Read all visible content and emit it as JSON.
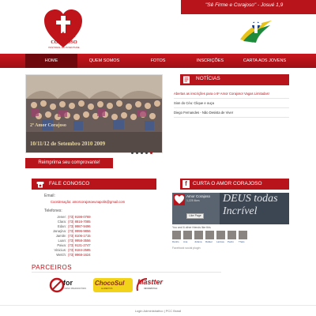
{
  "header": {
    "logo_text": "AMOR",
    "logo_text2": "CORAJOSO",
    "logo_sub": "PASTORAL DA JUVENTUDE",
    "quote": "\"Sê Firme e Corajoso\" - Josué 1,9"
  },
  "nav": {
    "items": [
      {
        "label": "HOME"
      },
      {
        "label": "QUEM SOMOS"
      },
      {
        "label": "FOTOS"
      },
      {
        "label": "INSCRIÇÕES"
      },
      {
        "label": "CARTA AOS JOVENS"
      }
    ]
  },
  "slider": {
    "caption": "2º Amor Corajoso",
    "date": "10/11/12 de Setembro 2010 2009",
    "dots": 5,
    "active_dot": 4
  },
  "reprint_label": "Reimprima seu comprovante!",
  "news": {
    "title": "NOTÍCIAS",
    "items": [
      {
        "text": "Abertas as inscrições para o 6º Amor Corajoso! Vagas Limitadas!",
        "highlight": true
      },
      {
        "text": "Sion do Céu: Clique e ouça",
        "highlight": false
      },
      {
        "text": "Diego Fernandes - Não Desista de Viver",
        "highlight": false
      }
    ]
  },
  "contact": {
    "title": "FALE CONOSCO",
    "email_label": "Email:",
    "email_line": "Coordenação: amorcorajosoeunapolis@gmail.com",
    "phones_label": "Telefones:",
    "phones": [
      {
        "name": "Jener:",
        "number": "(73) 9198-0769"
      },
      {
        "name": "Clara:",
        "number": "(73) 8816-7085"
      },
      {
        "name": "Edan:",
        "number": "(73) 9987-9496"
      },
      {
        "name": "Janaýna:",
        "number": "(73) 9996-9856"
      },
      {
        "name": "Jamile:",
        "number": "(73) 8106-1715"
      },
      {
        "name": "Luan:",
        "number": "(73) 9958-3556"
      },
      {
        "name": "Paiva:",
        "number": "(73) 9131-2747"
      },
      {
        "name": "Vinicius:",
        "number": "(73) 9184-2585"
      },
      {
        "name": "Welch:",
        "number": "(73) 9968-1624"
      }
    ]
  },
  "facebook": {
    "title": "CURTA O AMOR CORAJOSO",
    "page_name": "Amor Corajoso",
    "likes": "1,225 likes",
    "like_button": "Like Page",
    "big_text": "DEUS  todas",
    "big_text2": "Incrível",
    "friends_text": "You and 6 other friends like this",
    "faces": [
      "Danilo",
      "Ana",
      "Juliana",
      "Rafael",
      "Larissa",
      "Pedro",
      "Thaís"
    ],
    "plugin": "Facebook social plugin"
  },
  "partners": {
    "title": "PARCEIROS",
    "items": [
      {
        "name": "for",
        "sub": "CURSO PREPARATÓRIO"
      },
      {
        "name": "ChocoSul",
        "sub": "ALIMENTOS"
      },
      {
        "name": "Mastter",
        "sub": "INFORMÁTICA"
      }
    ]
  },
  "footer": {
    "line1": "Login Administrativo | PCC Brasil"
  },
  "colors": {
    "brand_red": "#b8141b",
    "nav_active": "#6e0a0e"
  }
}
